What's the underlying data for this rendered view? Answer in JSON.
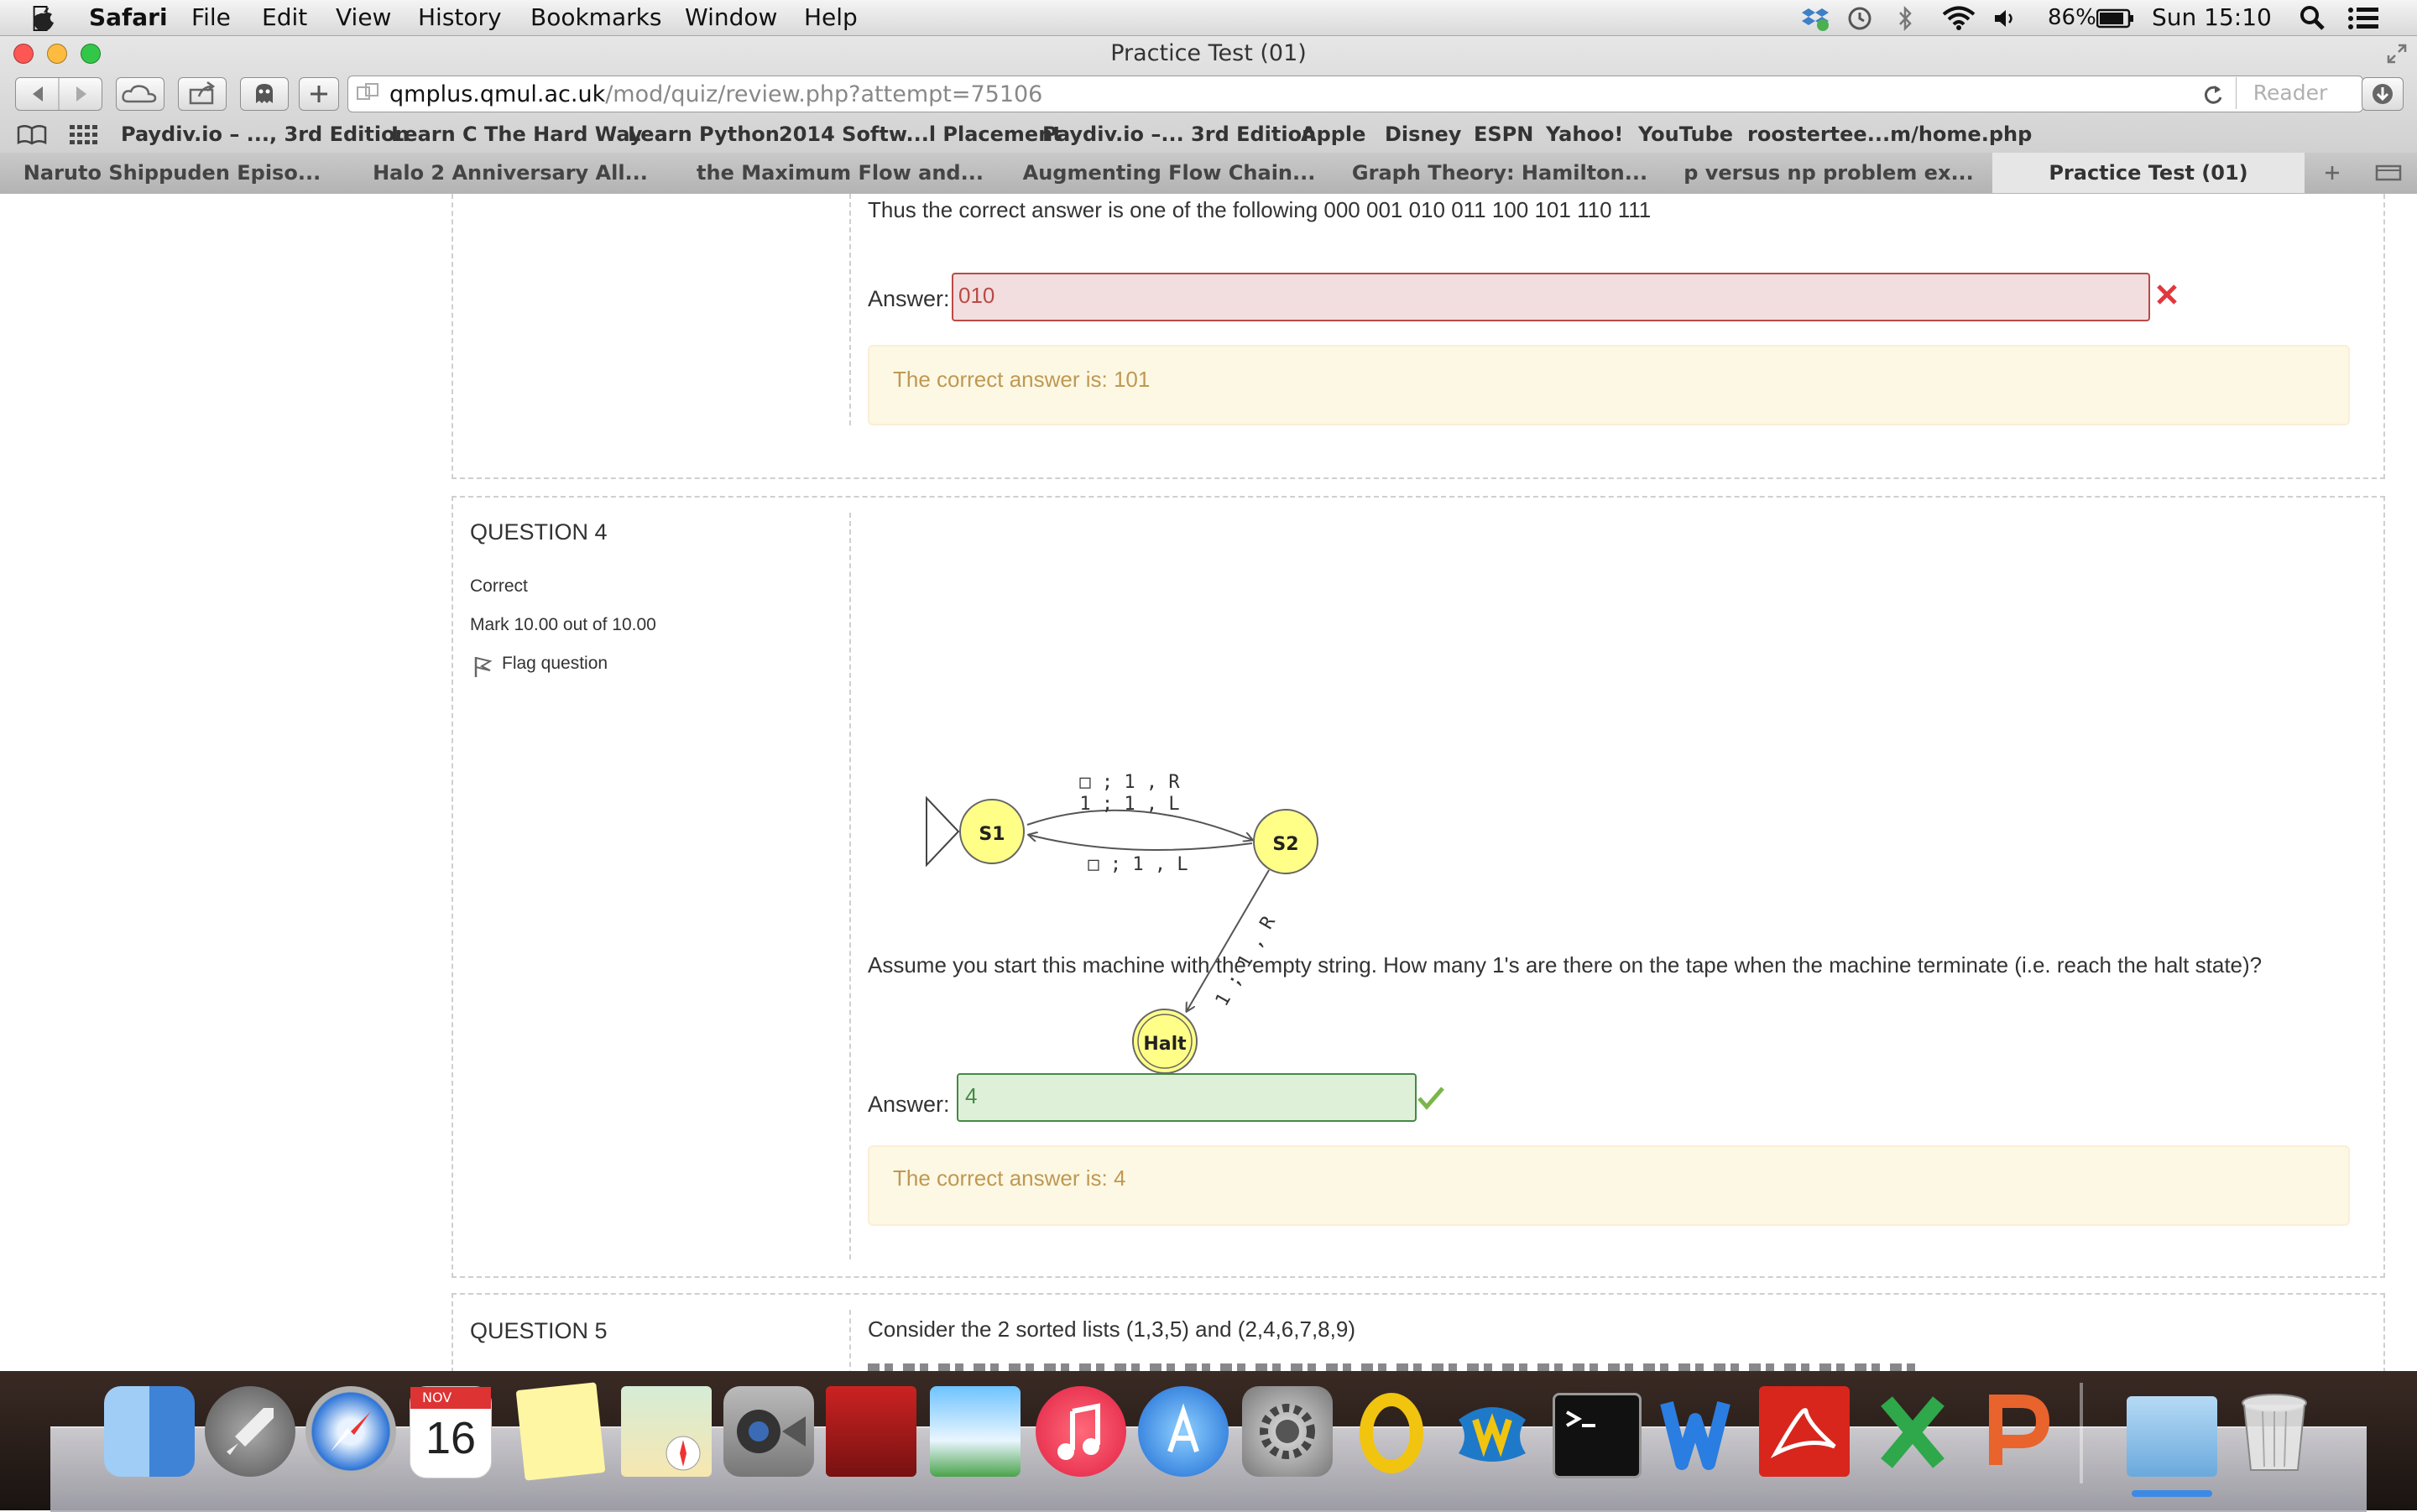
{
  "menubar": {
    "apple": "",
    "app": "Safari",
    "items": [
      "File",
      "Edit",
      "View",
      "History",
      "Bookmarks",
      "Window",
      "Help"
    ],
    "battery": "86%",
    "clock": "Sun 15:10"
  },
  "window": {
    "title": "Practice Test (01)"
  },
  "toolbar": {
    "url_host": "qmplus.qmul.ac.uk",
    "url_path": "/mod/quiz/review.php?attempt=75106",
    "reader": "Reader"
  },
  "bookmarks": [
    "Paydiv.io – ..., 3rd Edition",
    "Learn C The Hard Way",
    "Learn Python",
    "2014 Softw...l Placement",
    "Paydiv.io –... 3rd Edition",
    "Apple",
    "Disney",
    "ESPN",
    "Yahoo!",
    "YouTube",
    "roostertee...m/home.php"
  ],
  "tabs": [
    "Naruto Shippuden Episo...",
    "Halo 2 Anniversary All...",
    "the Maximum Flow and...",
    "Augmenting Flow Chain...",
    "Graph Theory: Hamilton...",
    "p versus np problem ex...",
    "Practice Test (01)"
  ],
  "q3": {
    "text": "Thus the correct answer is one of the following 000 001 010 011 100 101 110 111",
    "answer_label": "Answer:",
    "answer_value": "010",
    "feedback": "The correct answer is: 101"
  },
  "q4": {
    "heading": "QUESTION 4",
    "status": "Correct",
    "mark": "Mark 10.00 out of 10.00",
    "flag": "Flag question",
    "diagram": {
      "states": [
        "S1",
        "S2",
        "Halt"
      ],
      "edge_top_1": "□ ; 1 , R",
      "edge_top_2": "1 ; 1 , L",
      "edge_bottom": "□ ; 1 , L",
      "edge_halt": "1 ; 1 , R"
    },
    "question": "Assume you start this machine with the empty string. How many 1's are there on the tape when the machine terminate (i.e. reach the halt state)?",
    "answer_label": "Answer:",
    "answer_value": "4",
    "feedback": "The correct answer is: 4"
  },
  "q5": {
    "heading": "QUESTION 5",
    "text": "Consider the 2 sorted lists (1,3,5)  and (2,4,6,7,8,9)"
  },
  "dock": {
    "calendar_month": "NOV",
    "calendar_day": "16",
    "apps": [
      "finder",
      "launchpad",
      "safari",
      "calendar",
      "stickies",
      "maps",
      "facetime",
      "photo-booth",
      "iphoto",
      "itunes",
      "app-store",
      "system-preferences",
      "open-office",
      "fetch",
      "terminal",
      "word",
      "acrobat",
      "excel",
      "powerpoint",
      "folder",
      "trash"
    ]
  },
  "colors": {
    "wrong_bg": "#f2dede",
    "wrong_text": "#b94a48",
    "right_bg": "#dff0d8",
    "right_text": "#468847",
    "feedback_bg": "#fcf8e3",
    "feedback_text": "#c09853",
    "state_fill": "#ffff88"
  }
}
